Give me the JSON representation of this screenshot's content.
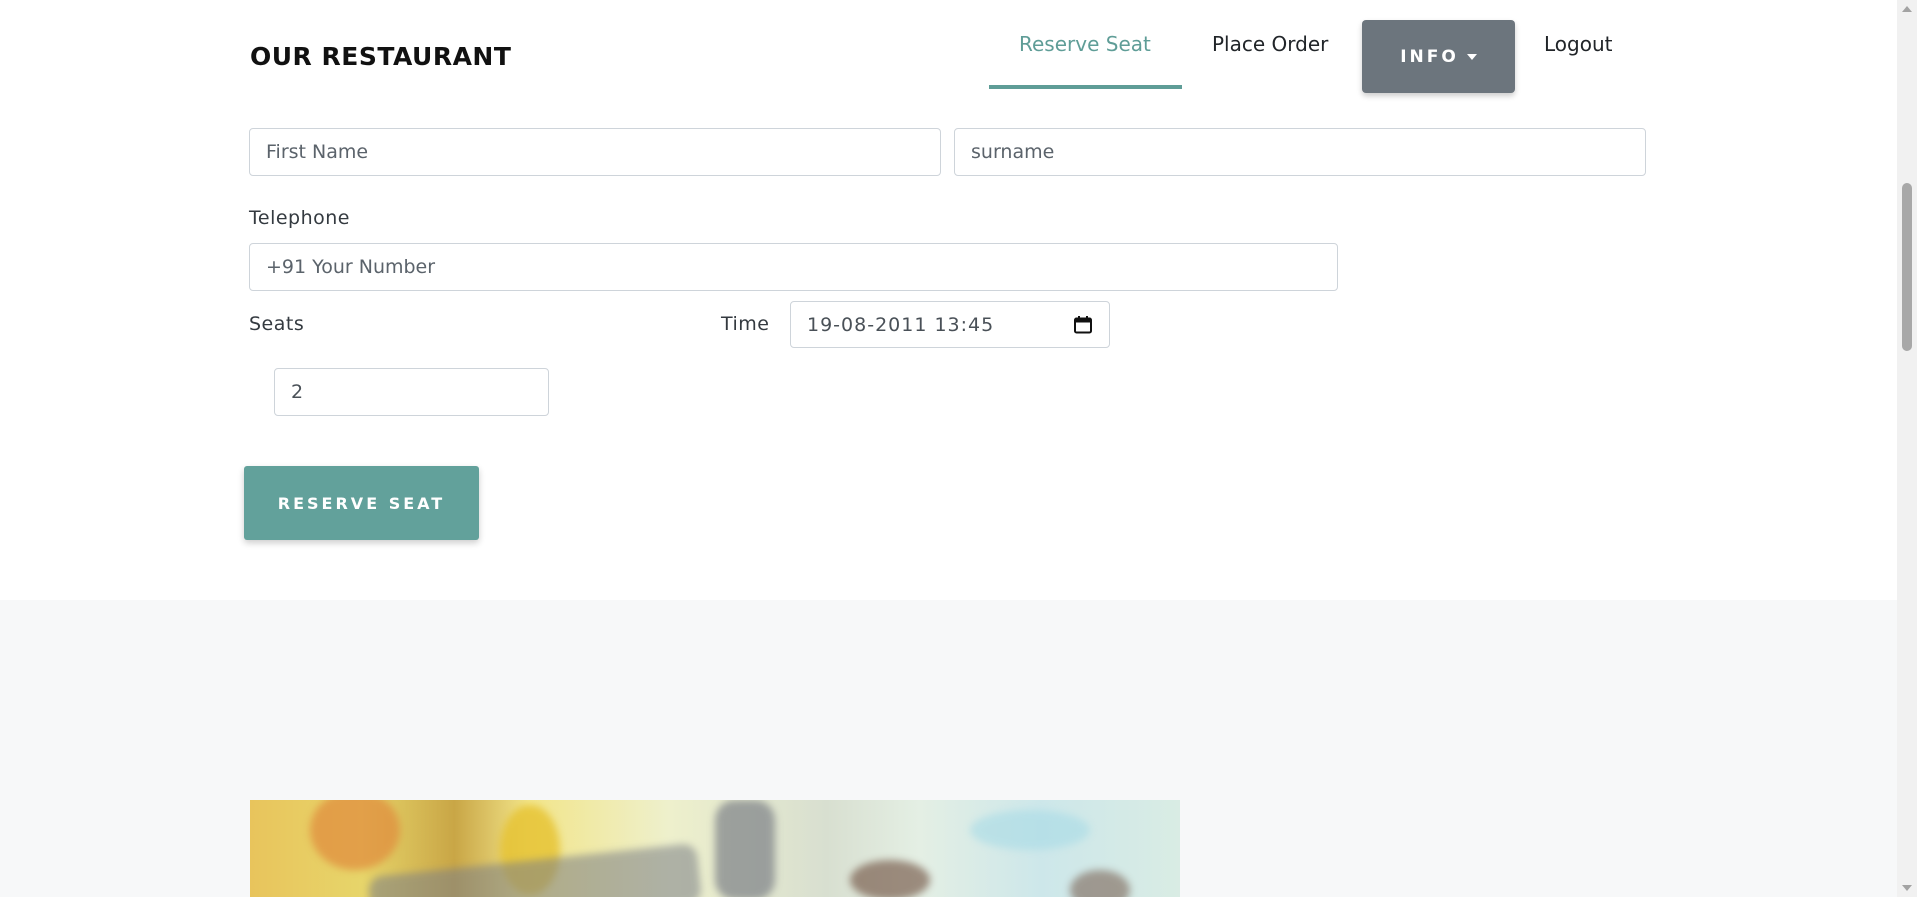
{
  "brand": "OUR RESTAURANT",
  "nav": {
    "reserve_seat": "Reserve Seat",
    "place_order": "Place Order",
    "info": "INFO",
    "logout": "Logout"
  },
  "form": {
    "first_name_placeholder": "First Name",
    "surname_placeholder": "surname",
    "telephone_label": "Telephone",
    "telephone_placeholder": "+91 Your Number",
    "seats_label": "Seats",
    "seats_value": "2",
    "time_label": "Time",
    "time_value": "19-08-2011 13:45",
    "submit_label": "RESERVE SEAT"
  },
  "colors": {
    "accent": "#5f9d97",
    "info_button": "#6c757d",
    "section_bg": "#f7f8f9"
  },
  "icons": {
    "dropdown": "caret-down-icon",
    "calendar": "calendar-icon"
  }
}
